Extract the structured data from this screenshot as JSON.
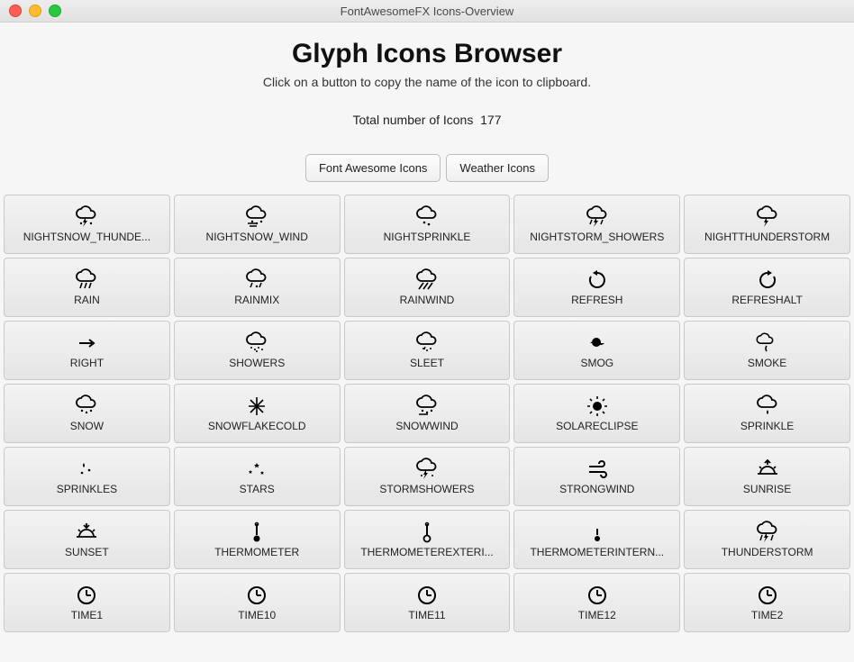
{
  "window_title": "FontAwesomeFX Icons-Overview",
  "page_title": "Glyph Icons Browser",
  "subtitle": "Click on a button to copy the name of the icon to clipboard.",
  "count_label": "Total number of Icons",
  "count_value": "177",
  "tabs": {
    "fa": "Font Awesome Icons",
    "weather": "Weather Icons"
  },
  "icons": [
    {
      "label": "NIGHTSNOW_THUNDE...",
      "icon": "cloud-snow-thunder"
    },
    {
      "label": "NIGHTSNOW_WIND",
      "icon": "cloud-snow-wind"
    },
    {
      "label": "NIGHTSPRINKLE",
      "icon": "cloud-sprinkle"
    },
    {
      "label": "NIGHTSTORM_SHOWERS",
      "icon": "cloud-storm-showers"
    },
    {
      "label": "NIGHTTHUNDERSTORM",
      "icon": "cloud-thunder"
    },
    {
      "label": "RAIN",
      "icon": "cloud-rain"
    },
    {
      "label": "RAINMIX",
      "icon": "cloud-rainmix"
    },
    {
      "label": "RAINWIND",
      "icon": "cloud-rainwind"
    },
    {
      "label": "REFRESH",
      "icon": "refresh"
    },
    {
      "label": "REFRESHALT",
      "icon": "refresh-alt"
    },
    {
      "label": "RIGHT",
      "icon": "arrow-right"
    },
    {
      "label": "SHOWERS",
      "icon": "cloud-showers"
    },
    {
      "label": "SLEET",
      "icon": "cloud-sleet"
    },
    {
      "label": "SMOG",
      "icon": "smog"
    },
    {
      "label": "SMOKE",
      "icon": "smoke"
    },
    {
      "label": "SNOW",
      "icon": "cloud-snow"
    },
    {
      "label": "SNOWFLAKECOLD",
      "icon": "snowflake"
    },
    {
      "label": "SNOWWIND",
      "icon": "cloud-snow-wind2"
    },
    {
      "label": "SOLARECLIPSE",
      "icon": "solar-eclipse"
    },
    {
      "label": "SPRINKLE",
      "icon": "cloud-one-drop"
    },
    {
      "label": "SPRINKLES",
      "icon": "sprinkles"
    },
    {
      "label": "STARS",
      "icon": "stars"
    },
    {
      "label": "STORMSHOWERS",
      "icon": "cloud-storm-showers2"
    },
    {
      "label": "STRONGWIND",
      "icon": "strongwind"
    },
    {
      "label": "SUNRISE",
      "icon": "sunrise"
    },
    {
      "label": "SUNSET",
      "icon": "sunset"
    },
    {
      "label": "THERMOMETER",
      "icon": "thermometer"
    },
    {
      "label": "THERMOMETEREXTERI...",
      "icon": "thermometer-ext"
    },
    {
      "label": "THERMOMETERINTERN...",
      "icon": "thermometer-int"
    },
    {
      "label": "THUNDERSTORM",
      "icon": "cloud-thunder-rain"
    },
    {
      "label": "TIME1",
      "icon": "clock"
    },
    {
      "label": "TIME10",
      "icon": "clock"
    },
    {
      "label": "TIME11",
      "icon": "clock"
    },
    {
      "label": "TIME12",
      "icon": "clock"
    },
    {
      "label": "TIME2",
      "icon": "clock"
    }
  ]
}
